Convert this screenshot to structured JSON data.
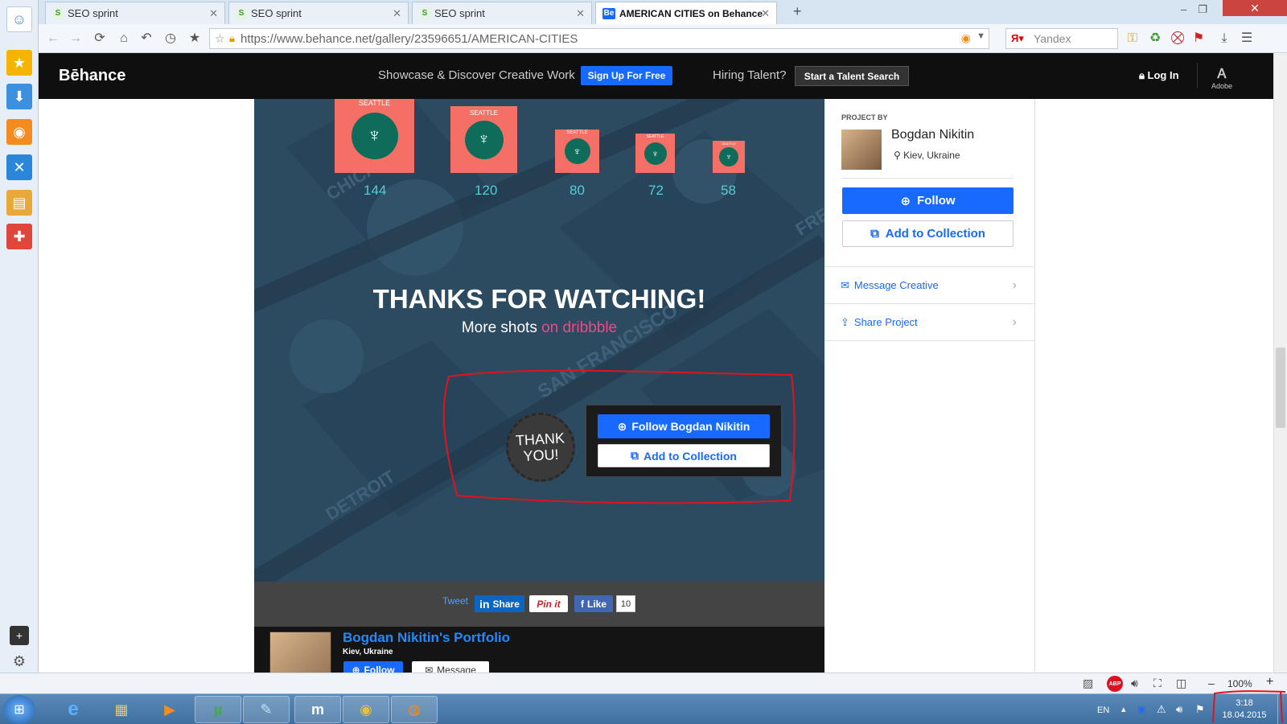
{
  "browser": {
    "tabs": [
      {
        "title": "SEO sprint",
        "active": false
      },
      {
        "title": "SEO sprint",
        "active": false
      },
      {
        "title": "SEO sprint",
        "active": false
      },
      {
        "title": "AMERICAN CITIES on Behance",
        "active": true
      }
    ],
    "new_tab_label": "+",
    "url": "https://www.behance.net/gallery/23596651/AMERICAN-CITIES",
    "search_placeholder": "Yandex",
    "zoom": "100%",
    "zoom_minus": "–",
    "zoom_plus": "+"
  },
  "behance_nav": {
    "logo": "Bēhance",
    "tagline": "Showcase & Discover Creative Work",
    "signup": "Sign Up For Free",
    "hiring": "Hiring Talent?",
    "talent_search": "Start a Talent Search",
    "login": "Log In",
    "adobe": "Adobe"
  },
  "project": {
    "icons": [
      {
        "label": "SEATTLE",
        "size": "144"
      },
      {
        "label": "SEATTLE",
        "size": "120"
      },
      {
        "label": "SEATTLE",
        "size": "80"
      },
      {
        "label": "SEATTLE",
        "size": "72"
      },
      {
        "label": "SEATTLE",
        "size": "58"
      }
    ],
    "bg_words": [
      "CHICAGO",
      "SAN FRANCISCO",
      "DETROIT",
      "FRE"
    ],
    "thanks": "THANKS FOR WATCHING!",
    "more_shots_prefix": "More shots",
    "more_shots_link": "on dribbble",
    "badge_line1": "THANK",
    "badge_line2": "YOU!",
    "follow_owner": "Follow Bogdan Nikitin",
    "add_collection": "Add to Collection"
  },
  "social": {
    "tweet": "Tweet",
    "linkedin": "Share",
    "pinterest": "Pin it",
    "fb_like": "Like",
    "fb_count": "10"
  },
  "portfolio": {
    "title": "Bogdan Nikitin's Portfolio",
    "location": "Kiev, Ukraine",
    "follow": "Follow",
    "message": "Message"
  },
  "sidebar": {
    "project_by": "PROJECT BY",
    "owner_name": "Bogdan Nikitin",
    "owner_location": "Kiev, Ukraine",
    "follow": "Follow",
    "add_collection": "Add to Collection",
    "message_creative": "Message Creative",
    "share_project": "Share Project"
  },
  "statusbar": {
    "abp": "ABP"
  },
  "taskbar": {
    "lang": "EN",
    "time": "3:18",
    "date": "18.04.2015"
  },
  "colors": {
    "behance_blue": "#1769ff",
    "project_bg": "#2c4a60",
    "icon_tile": "#f46f66",
    "icon_circle": "#0f6b5a",
    "dribbble_pink": "#ea4c89",
    "annotation_red": "#e0141e"
  }
}
